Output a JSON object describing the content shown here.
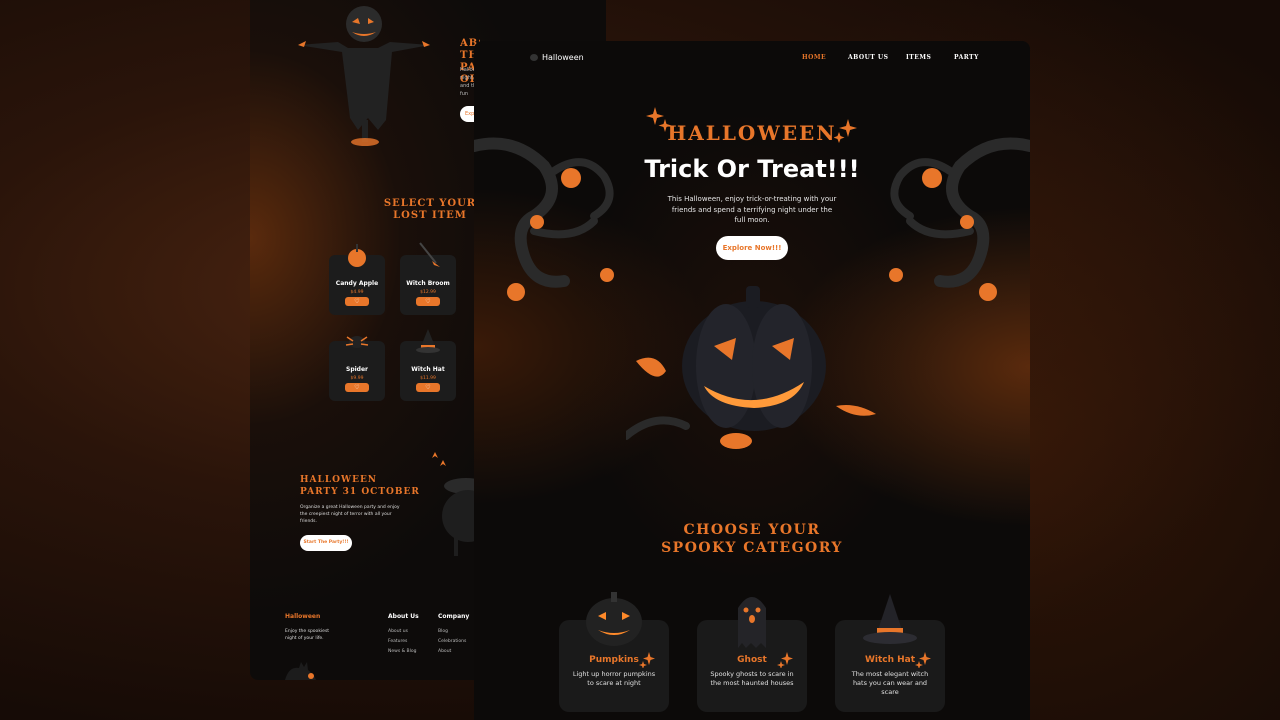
{
  "back_page": {
    "about_title": "ABOUT THE PARTY OF",
    "about_text": "Halloween night, and the fun",
    "about_button": "Exp",
    "select_title_line1": "SELECT YOUR",
    "select_title_line2": "LOST ITEM",
    "items": [
      {
        "name": "Candy Apple",
        "price": "$4.99"
      },
      {
        "name": "Witch Broom",
        "price": "$12.99"
      },
      {
        "name": "Spider",
        "price": "$9.99"
      },
      {
        "name": "Witch Hat",
        "price": "$11.99"
      }
    ],
    "party_title_line1": "HALLOWEEN",
    "party_title_line2": "PARTY 31 OCTOBER",
    "party_text": "Organize a great Halloween party and enjoy the creepiest night of terror with all your friends.",
    "party_button": "Start The Party!!!",
    "footer": {
      "logo": "Halloween",
      "tagline": "Enjoy the spookiest night of your life.",
      "col1_title": "About Us",
      "col1_links": [
        "About us",
        "Features",
        "News & Blog"
      ],
      "col2_title": "Company",
      "col2_links": [
        "Blog",
        "Celebrations",
        "About"
      ]
    }
  },
  "front_page": {
    "logo": "Halloween",
    "nav": [
      "HOME",
      "ABOUT US",
      "ITEMS",
      "PARTY"
    ],
    "hero": {
      "eyebrow": "HALLOWEEN",
      "title": "Trick Or Treat!!!",
      "description": "This Halloween, enjoy trick-or-treating with your friends and spend a terrifying night under the full moon.",
      "button": "Explore Now!!!"
    },
    "choose_title_line1": "CHOOSE YOUR",
    "choose_title_line2": "SPOOKY CATEGORY",
    "categories": [
      {
        "name": "Pumpkins",
        "description": "Light up horror pumpkins to scare at night"
      },
      {
        "name": "Ghost",
        "description": "Spooky ghosts to scare in the most haunted houses"
      },
      {
        "name": "Witch Hat",
        "description": "The most elegant witch hats you can wear and scare"
      }
    ]
  },
  "colors": {
    "accent": "#e8762a",
    "background": "#0c0a09",
    "card": "#1a1a1a"
  }
}
